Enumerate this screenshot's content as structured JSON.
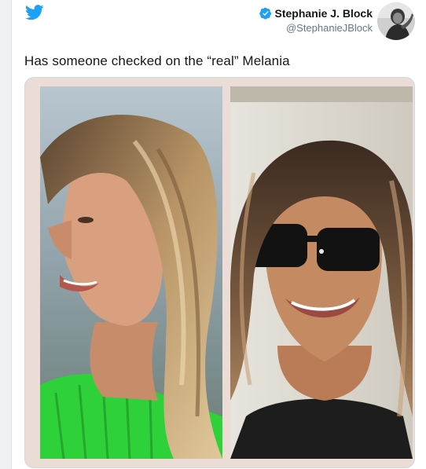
{
  "tweet": {
    "author_name": "Stephanie J. Block",
    "author_handle": "@StephanieJBlock",
    "text": "Has someone checked on the “real” Melania"
  },
  "icons": {
    "logo": "twitter-bird-icon",
    "verified": "verified-badge-icon"
  },
  "colors": {
    "brand": "#1da1f2",
    "text": "#14171a",
    "secondary": "#657786"
  }
}
